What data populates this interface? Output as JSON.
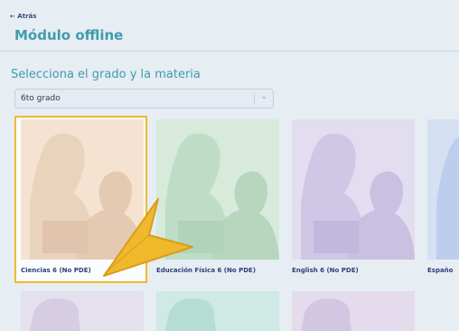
{
  "header": {
    "back_label": "← Atrás",
    "title": "Módulo offline"
  },
  "section": {
    "subtitle": "Selecciona el grado y la materia"
  },
  "grade_select": {
    "value": "6to grado",
    "chevron_icon": "chevron-down-icon"
  },
  "cards": [
    {
      "label": "Ciencias 6 (No PDE)",
      "bg": "#f6e2d0",
      "figure": "#ead3bd",
      "selected": true
    },
    {
      "label": "Educación Física 6 (No PDE)",
      "bg": "#d7eadb",
      "figure": "#bfdcc6",
      "selected": false
    },
    {
      "label": "English 6 (No PDE)",
      "bg": "#e3ddf0",
      "figure": "#cfc7e5",
      "selected": false
    },
    {
      "label": "Españo",
      "bg": "#d5e0f3",
      "figure": "#bccdee",
      "selected": false
    }
  ],
  "bottom_cards": [
    {
      "bg": "#e5e0ed"
    },
    {
      "bg": "#cfe9e4"
    },
    {
      "bg": "#e4dcec"
    }
  ],
  "colors": {
    "accent": "#3f9cab",
    "selected_border": "#f0b92c",
    "label": "#2f3e7a"
  }
}
